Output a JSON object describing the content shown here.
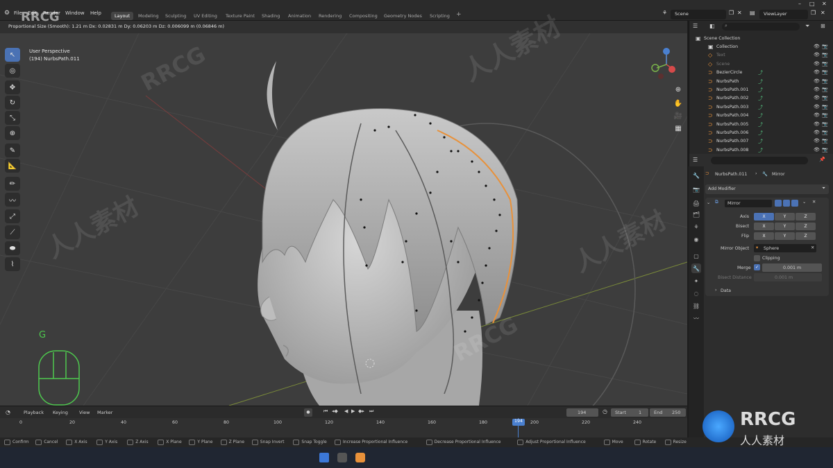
{
  "app": {
    "menu": [
      "File",
      "Edit",
      "Render",
      "Window",
      "Help"
    ],
    "workspace_tabs": [
      "Layout",
      "Modeling",
      "Sculpting",
      "UV Editing",
      "Texture Paint",
      "Shading",
      "Animation",
      "Rendering",
      "Compositing",
      "Geometry Nodes",
      "Scripting"
    ],
    "active_tab": "Layout",
    "add_tab": "+",
    "scene": "Scene",
    "view_layer": "ViewLayer"
  },
  "viewport": {
    "header_text": "Proportional Size (Smooth): 1.21 m   Dx: 0.02831 m   Dy: 0.06203 m   Dz: 0.006099 m (0.06846 m)",
    "perspective": "User Perspective",
    "object_label": "(194) NurbsPath.011",
    "key_hint": "G"
  },
  "outliner": {
    "root": "Scene Collection",
    "items": [
      {
        "label": "Collection",
        "dim": false
      },
      {
        "label": "Text",
        "dim": true
      },
      {
        "label": "Scene",
        "dim": true
      },
      {
        "label": "BezierCircle",
        "dim": false
      },
      {
        "label": "NurbsPath",
        "dim": false
      },
      {
        "label": "NurbsPath.001",
        "dim": false
      },
      {
        "label": "NurbsPath.002",
        "dim": false
      },
      {
        "label": "NurbsPath.003",
        "dim": false
      },
      {
        "label": "NurbsPath.004",
        "dim": false
      },
      {
        "label": "NurbsPath.005",
        "dim": false
      },
      {
        "label": "NurbsPath.006",
        "dim": false
      },
      {
        "label": "NurbsPath.007",
        "dim": false
      },
      {
        "label": "NurbsPath.008",
        "dim": false
      }
    ]
  },
  "properties": {
    "object_name": "NurbsPath.011",
    "modifier_label": "Mirror",
    "add_modifier": "Add Modifier",
    "modifier_name": "Mirror",
    "axis_label": "Axis",
    "bisect_label": "Bisect",
    "flip_label": "Flip",
    "x": "X",
    "y": "Y",
    "z": "Z",
    "mirror_object_label": "Mirror Object",
    "mirror_object": "Sphere",
    "clipping_label": "Clipping",
    "merge_label": "Merge",
    "merge_value": "0.001 m",
    "bisect_distance_label": "Bisect Distance",
    "bisect_distance_value": "0.001 m",
    "data_label": "Data"
  },
  "timeline": {
    "menu": [
      "Playback",
      "Keying",
      "View",
      "Marker"
    ],
    "current_frame": "194",
    "start_label": "Start",
    "start": "1",
    "end_label": "End",
    "end": "250",
    "ticks": [
      "0",
      "20",
      "40",
      "60",
      "80",
      "100",
      "120",
      "140",
      "160",
      "180",
      "200",
      "220",
      "240"
    ],
    "playhead": "194"
  },
  "status_bar": {
    "items": [
      "Confirm",
      "Cancel",
      "X Axis",
      "Y Axis",
      "Z Axis",
      "X Plane",
      "Y Plane",
      "Z Plane",
      "Snap Invert",
      "Snap Toggle",
      "Increase Proportional Influence",
      "Decrease Proportional Influence",
      "Adjust Proportional Influence",
      "Move",
      "Rotate",
      "Resize"
    ]
  },
  "watermarks": {
    "brand": "RRCG",
    "cn": "人人素材"
  },
  "colors": {
    "accent": "#4a72b4",
    "selection": "#e8913a",
    "bg_viewport": "#3d3d3d"
  }
}
